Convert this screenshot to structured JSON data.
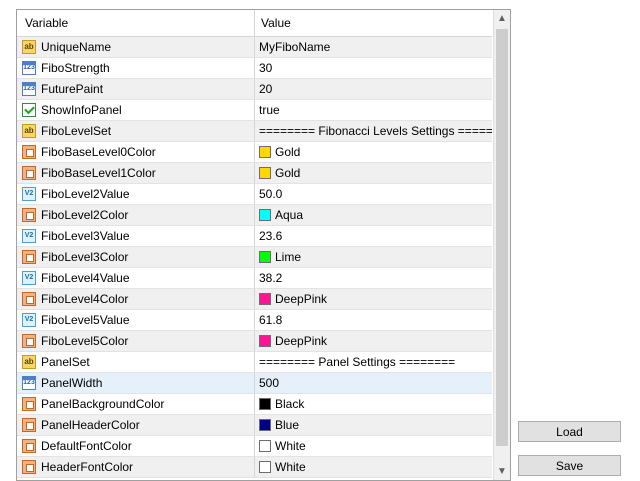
{
  "header": {
    "variable": "Variable",
    "value": "Value"
  },
  "rows": [
    {
      "type": "ab",
      "name": "UniqueName",
      "value": "MyFiboName"
    },
    {
      "type": "num",
      "name": "FiboStrength",
      "value": "30"
    },
    {
      "type": "num",
      "name": "FuturePaint",
      "value": "20"
    },
    {
      "type": "bool",
      "name": "ShowInfoPanel",
      "value": "true"
    },
    {
      "type": "ab",
      "name": "FiboLevelSet",
      "value": "======== Fibonacci Levels Settings ========"
    },
    {
      "type": "color",
      "name": "FiboBaseLevel0Color",
      "value": "Gold",
      "swatch": "#ffd700"
    },
    {
      "type": "color",
      "name": "FiboBaseLevel1Color",
      "value": "Gold",
      "swatch": "#ffd700"
    },
    {
      "type": "dbl",
      "name": "FiboLevel2Value",
      "value": "50.0"
    },
    {
      "type": "color",
      "name": "FiboLevel2Color",
      "value": "Aqua",
      "swatch": "#00ffff"
    },
    {
      "type": "dbl",
      "name": "FiboLevel3Value",
      "value": "23.6"
    },
    {
      "type": "color",
      "name": "FiboLevel3Color",
      "value": "Lime",
      "swatch": "#00ff00"
    },
    {
      "type": "dbl",
      "name": "FiboLevel4Value",
      "value": "38.2"
    },
    {
      "type": "color",
      "name": "FiboLevel4Color",
      "value": "DeepPink",
      "swatch": "#ff1493"
    },
    {
      "type": "dbl",
      "name": "FiboLevel5Value",
      "value": "61.8"
    },
    {
      "type": "color",
      "name": "FiboLevel5Color",
      "value": "DeepPink",
      "swatch": "#ff1493"
    },
    {
      "type": "ab",
      "name": "PanelSet",
      "value": "======== Panel Settings ========"
    },
    {
      "type": "num",
      "name": "PanelWidth",
      "value": "500",
      "selected": true
    },
    {
      "type": "color",
      "name": "PanelBackgroundColor",
      "value": "Black",
      "swatch": "#000000"
    },
    {
      "type": "color",
      "name": "PanelHeaderColor",
      "value": "Blue",
      "swatch": "#000080"
    },
    {
      "type": "color",
      "name": "DefaultFontColor",
      "value": "White",
      "swatch": "#ffffff"
    },
    {
      "type": "color",
      "name": "HeaderFontColor",
      "value": "White",
      "swatch": "#ffffff"
    }
  ],
  "icons": {
    "ab": "ab",
    "num": "123",
    "dbl": "V2",
    "scroll_up": "▲",
    "scroll_down": "▼"
  },
  "buttons": {
    "load": "Load",
    "save": "Save"
  }
}
